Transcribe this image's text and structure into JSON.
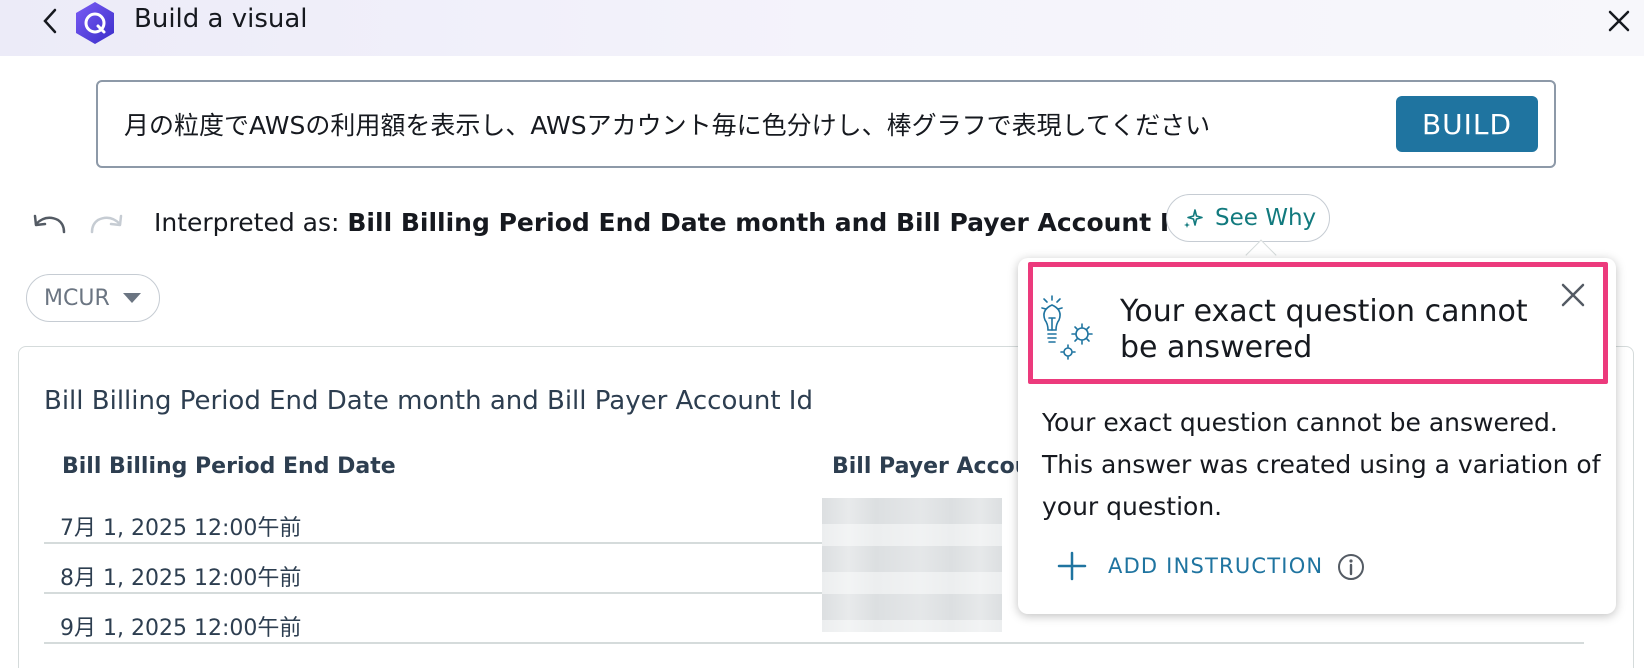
{
  "header": {
    "title": "Build a visual",
    "back_icon": "chevron-left-icon",
    "logo_icon": "quicksight-q-logo",
    "close_icon": "close-icon"
  },
  "query": {
    "text": "月の粒度でAWSの利用額を表示し、AWSアカウント毎に色分けし、棒グラフで表現してください",
    "build_label": "BUILD"
  },
  "interpretation": {
    "prefix": "Interpreted as: ",
    "value": "Bill Billing Period End Date month and Bill Payer Account Id.",
    "see_why_label": "See Why"
  },
  "dataset_selector": {
    "label": "MCUR"
  },
  "visual": {
    "title": "Bill Billing Period End Date month and Bill Payer Account Id",
    "columns": [
      "Bill Billing Period End Date",
      "Bill Payer Account"
    ],
    "rows": [
      "7月 1, 2025 12:00午前",
      "8月 1, 2025 12:00午前",
      "9月 1, 2025 12:00午前"
    ]
  },
  "popover": {
    "title": "Your exact question cannot be answered",
    "body": "Your exact question cannot be answered. This answer was created using a variation of your question.",
    "add_instruction_label": "ADD INSTRUCTION",
    "icons": [
      "lightbulb-gear-icon",
      "close-icon",
      "plus-icon",
      "info-icon"
    ]
  },
  "colors": {
    "primary_button": "#1f74a0",
    "link_teal": "#127a7e",
    "highlight": "#ec3a7c"
  }
}
